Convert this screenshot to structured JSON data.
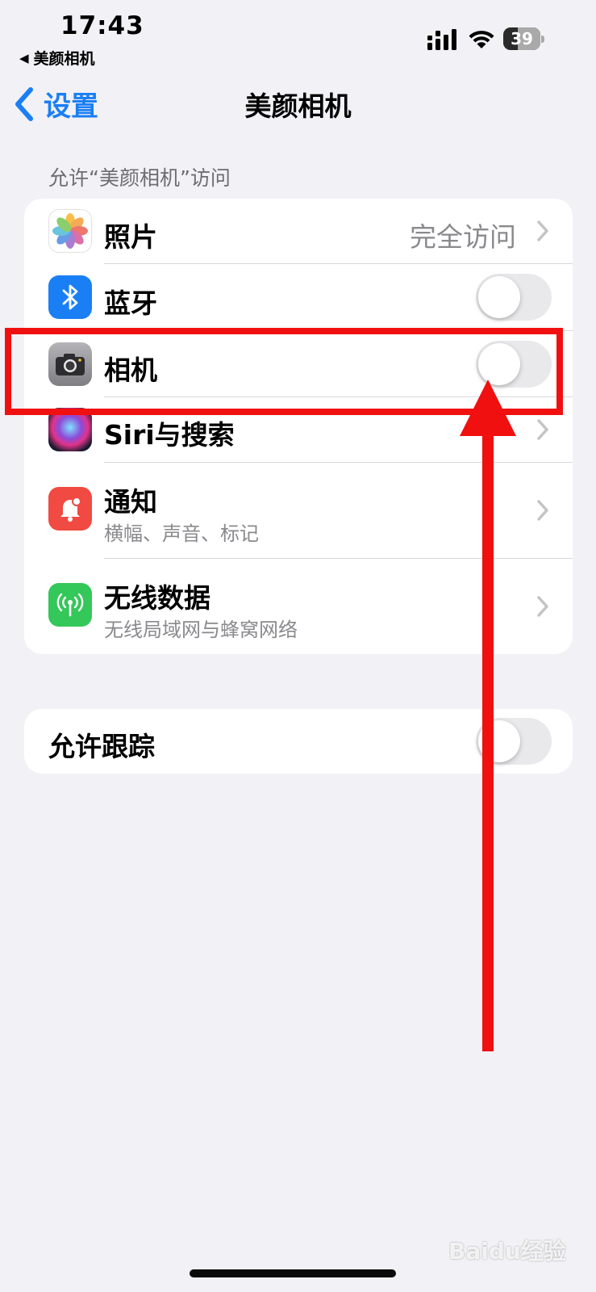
{
  "status_bar": {
    "time": "17:43",
    "back_app": "美颜相机",
    "back_glyph": "◀",
    "battery": "39",
    "battery_level": 0.39,
    "icons": [
      "signal-icon",
      "wifi-icon",
      "battery-icon"
    ]
  },
  "nav": {
    "back_label": "设置",
    "title": "美颜相机",
    "accent_color": "#1a7ff5"
  },
  "section_header": "允许“美颜相机”访问",
  "rows": [
    {
      "label": "照片",
      "value": "完全访问",
      "icon": "photos-icon",
      "control": "chevron"
    },
    {
      "label": "蓝牙",
      "icon": "bluetooth-icon",
      "control": "toggle",
      "on": false
    },
    {
      "label": "相机",
      "icon": "camera-icon",
      "control": "toggle",
      "on": false
    },
    {
      "label": "Siri与搜索",
      "icon": "siri-icon",
      "control": "chevron"
    },
    {
      "label": "通知",
      "sublabel": "横幅、声音、标记",
      "icon": "notifications-icon",
      "control": "chevron"
    },
    {
      "label": "无线数据",
      "sublabel": "无线局域网与蜂窝网络",
      "icon": "wireless-data-icon",
      "control": "chevron"
    }
  ],
  "tracking": {
    "label": "允许跟踪",
    "on": false
  },
  "annotation": {
    "color": "#f01010",
    "target": "相机"
  },
  "watermark": "Baidu经验"
}
